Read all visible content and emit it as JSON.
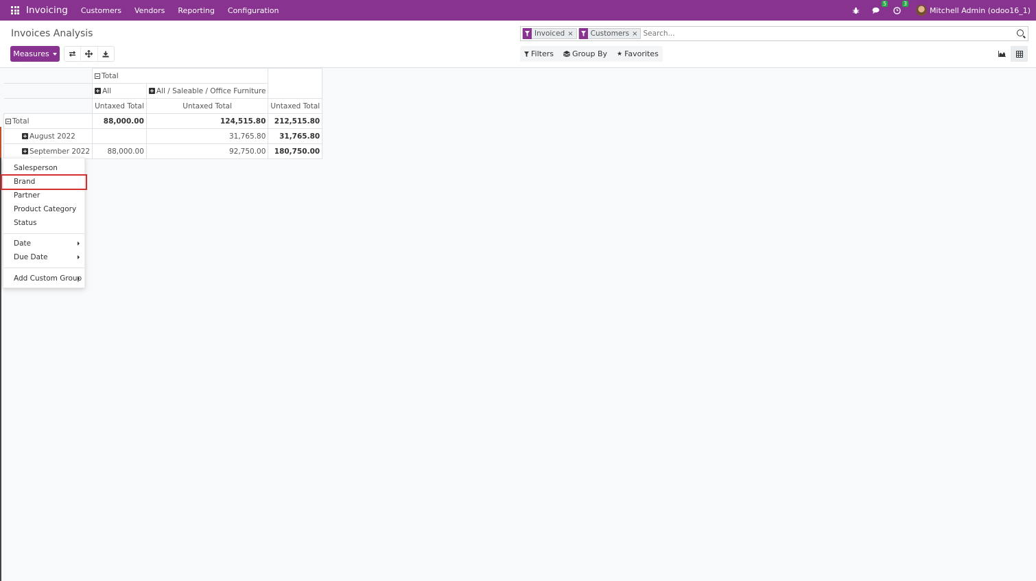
{
  "app": {
    "name": "Invoicing"
  },
  "nav": {
    "items": [
      "Customers",
      "Vendors",
      "Reporting",
      "Configuration"
    ]
  },
  "systray": {
    "messages_count": "5",
    "activities_count": "3",
    "user": "Mitchell Admin (odoo16_1)"
  },
  "page": {
    "title": "Invoices Analysis"
  },
  "toolbar": {
    "measures_label": "Measures"
  },
  "search": {
    "facets": [
      {
        "label": "Invoiced"
      },
      {
        "label": "Customers"
      }
    ],
    "placeholder": "Search...",
    "filters_label": "Filters",
    "groupby_label": "Group By",
    "favorites_label": "Favorites"
  },
  "pivot": {
    "header_total": "Total",
    "col_groups": [
      "All",
      "All / Saleable / Office Furniture"
    ],
    "measure": "Untaxed Total",
    "rows": [
      {
        "label": "Total",
        "values": [
          "88,000.00",
          "124,515.80",
          "212,515.80"
        ]
      },
      {
        "label": "August 2022",
        "values": [
          "",
          "31,765.80",
          "31,765.80"
        ]
      },
      {
        "label": "September 2022",
        "values": [
          "88,000.00",
          "92,750.00",
          "180,750.00"
        ]
      }
    ]
  },
  "groupby_menu": {
    "items": [
      "Salesperson",
      "Brand",
      "Partner",
      "Product Category",
      "Status"
    ],
    "date_items": [
      "Date",
      "Due Date"
    ],
    "custom": "Add Custom Group",
    "highlighted": "Brand"
  },
  "colors": {
    "brand": "#87338f",
    "badge": "#28a745",
    "highlight": "#d32f2f"
  }
}
